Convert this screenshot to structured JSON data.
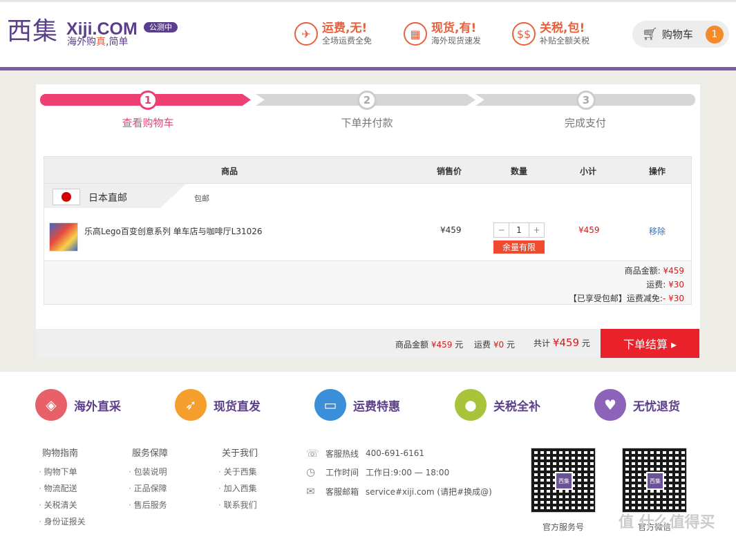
{
  "header": {
    "logo_glyph": "西集",
    "logo_en": "Xiji.COM",
    "logo_slogan_a": "海外购",
    "logo_slogan_b": "真",
    "logo_slogan_c": ",简单",
    "beta": "公测中",
    "promos": [
      {
        "title": "运费,无!",
        "sub": "全场运费全免",
        "icon": "airplane-icon"
      },
      {
        "title": "现货,有!",
        "sub": "海外现货速发",
        "icon": "gift-icon"
      },
      {
        "title": "关税,包!",
        "sub": "补贴全额关税",
        "icon": "dollar-icon"
      }
    ],
    "cart_label": "购物车",
    "cart_count": "1"
  },
  "steps": [
    {
      "num": "1",
      "label": "查看购物车",
      "active": true
    },
    {
      "num": "2",
      "label": "下单并付款",
      "active": false
    },
    {
      "num": "3",
      "label": "完成支付",
      "active": false
    }
  ],
  "table": {
    "headers": [
      "商品",
      "销售价",
      "数量",
      "小计",
      "操作"
    ],
    "shop": {
      "name": "日本直邮",
      "ship": "包邮"
    },
    "item": {
      "name": "乐高Lego百变创意系列 单车店与咖啡厅L31026",
      "price": "¥459",
      "qty": "1",
      "qty_minus": "−",
      "qty_plus": "+",
      "limited": "余量有限",
      "subtotal": "¥459",
      "remove": "移除"
    },
    "summary": {
      "goods_label": "商品金额:",
      "goods_val": "¥459",
      "ship_label": "运费:",
      "ship_val": "¥30",
      "discount_label": "【已享受包邮】运费减免:",
      "discount_val": "- ¥30"
    }
  },
  "footbar": {
    "goods_label": "商品金额",
    "goods_val": "¥459",
    "goods_unit": "元",
    "ship_label": "运费",
    "ship_val": "¥0",
    "ship_unit": "元",
    "total_label": "共计",
    "total_val": "¥459",
    "total_unit": "元",
    "checkout": "下单结算 ▸"
  },
  "features": [
    {
      "label": "海外直采",
      "icon": "bag-icon",
      "color": "#e8606a"
    },
    {
      "label": "现货直发",
      "icon": "rocket-icon",
      "color": "#f5a02e"
    },
    {
      "label": "运费特惠",
      "icon": "truck-icon",
      "color": "#3b8fd9"
    },
    {
      "label": "关税全补",
      "icon": "piggy-bank-icon",
      "color": "#a8c43a"
    },
    {
      "label": "无忧退货",
      "icon": "return-icon",
      "color": "#8c63b8"
    }
  ],
  "footer": {
    "cols": [
      {
        "title": "购物指南",
        "items": [
          "购物下单",
          "物流配送",
          "关税清关",
          "身份证报关"
        ]
      },
      {
        "title": "服务保障",
        "items": [
          "包装说明",
          "正品保障",
          "售后服务"
        ]
      },
      {
        "title": "关于我们",
        "items": [
          "关于西集",
          "加入西集",
          "联系我们"
        ]
      }
    ],
    "contact": [
      {
        "icon": "phone-icon",
        "label": "客服热线",
        "value": "400-691-6161"
      },
      {
        "icon": "clock-icon",
        "label": "工作时间",
        "value": "工作日:9:00 — 18:00"
      },
      {
        "icon": "mail-icon",
        "label": "客服邮箱",
        "value": "service#xiji.com (请把#换成@)"
      }
    ],
    "qr1_label": "官方服务号",
    "qr2_label": "官方微信",
    "qr_center": "西集",
    "watermark": "值 什么值得买"
  }
}
